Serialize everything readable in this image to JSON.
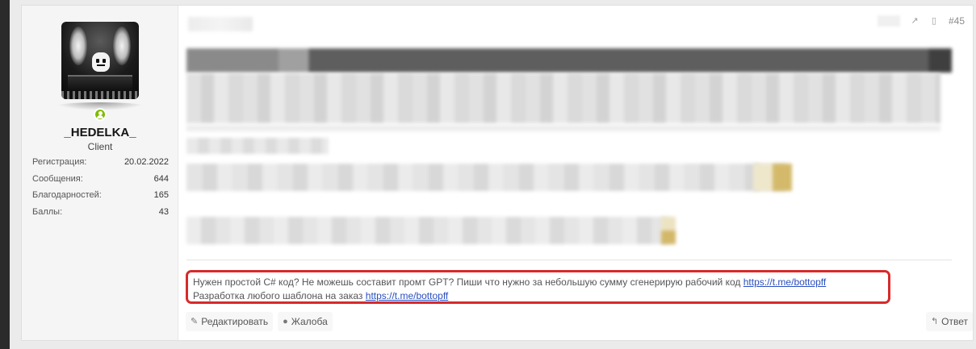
{
  "post": {
    "number": "#45",
    "signature": {
      "line1": "Нужен простой C# код? Не можешь составит промт GPT? Пиши что нужно за небольшую сумму сгенерирую рабочий код",
      "link1": "https://t.me/bottopff",
      "line2": "Разработка любого шаблона на заказ",
      "link2": "https://t.me/bottopff"
    },
    "actions": {
      "edit_label": "Редактировать",
      "report_label": "Жалоба",
      "reply_label": "Ответ"
    }
  },
  "user": {
    "name": "_HEDELKA_",
    "title": "Client",
    "stats": [
      {
        "label": "Регистрация:",
        "value": "20.02.2022"
      },
      {
        "label": "Сообщения:",
        "value": "644"
      },
      {
        "label": "Благодарностей:",
        "value": "165"
      },
      {
        "label": "Баллы:",
        "value": "43"
      }
    ]
  },
  "icons": {
    "share": "share-icon",
    "bookmark": "bookmark-icon",
    "edit": "pencil-icon",
    "report": "report-icon",
    "reply": "reply-icon",
    "online": "online-status-icon"
  },
  "colors": {
    "signature_border": "#d72a2a",
    "link": "#2a4fbf",
    "online": "#7fbb00"
  }
}
